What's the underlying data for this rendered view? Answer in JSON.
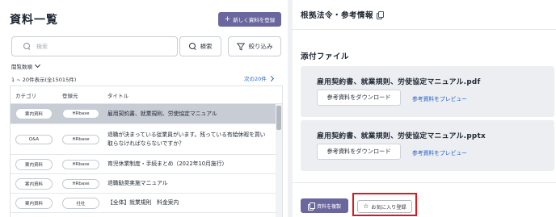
{
  "list": {
    "title": "資料一覧",
    "new_button": "新しく資料を登録",
    "search_placeholder": "検索",
    "search_button": "検索",
    "filter_button": "絞り込み",
    "sort_label": "閲覧数順",
    "count_text": "1 ~ 20件表示(全15015件)",
    "next_link": "次の20件",
    "columns": {
      "category": "カテゴリ",
      "registrant": "登録元",
      "title": "タイトル"
    },
    "rows": [
      {
        "category": "案内資料",
        "registrant": "HRbase",
        "title": "雇用契約書、就業規則、労使協定マニュアル",
        "selected": true
      },
      {
        "category": "Q&A",
        "registrant": "HRbase",
        "title": "退職が決まっている従業員がいます。残っている有給休暇を買い取らなければならないですか？",
        "selected": false
      },
      {
        "category": "案内資料",
        "registrant": "HRbase",
        "title": "育児休業制度・手続まとめ（2022年10月施行）",
        "selected": false
      },
      {
        "category": "案内資料",
        "registrant": "HRbase",
        "title": "退職勧奨実施マニュアル",
        "selected": false
      },
      {
        "category": "案内資料",
        "registrant": "社社",
        "title": "【全体】就業規則　料金案内",
        "selected": false
      }
    ]
  },
  "detail": {
    "law_title": "根拠法令・参考情報",
    "attach_title": "添付ファイル",
    "files": [
      {
        "name": "雇用契約書、就業規則、労使協定マニュアル.pdf",
        "download": "参考資料をダウンロード",
        "preview": "参考資料をプレビュー"
      },
      {
        "name": "雇用契約書、就業規則、労使協定マニュアル.pptx",
        "download": "参考資料をダウンロード",
        "preview": "参考資料をプレビュー"
      }
    ],
    "copy_button": "資料を複製",
    "favorite_button": "お気に入り登録"
  },
  "colors": {
    "accent": "#6a679e",
    "link": "#2563c9",
    "highlight": "#d81920"
  }
}
